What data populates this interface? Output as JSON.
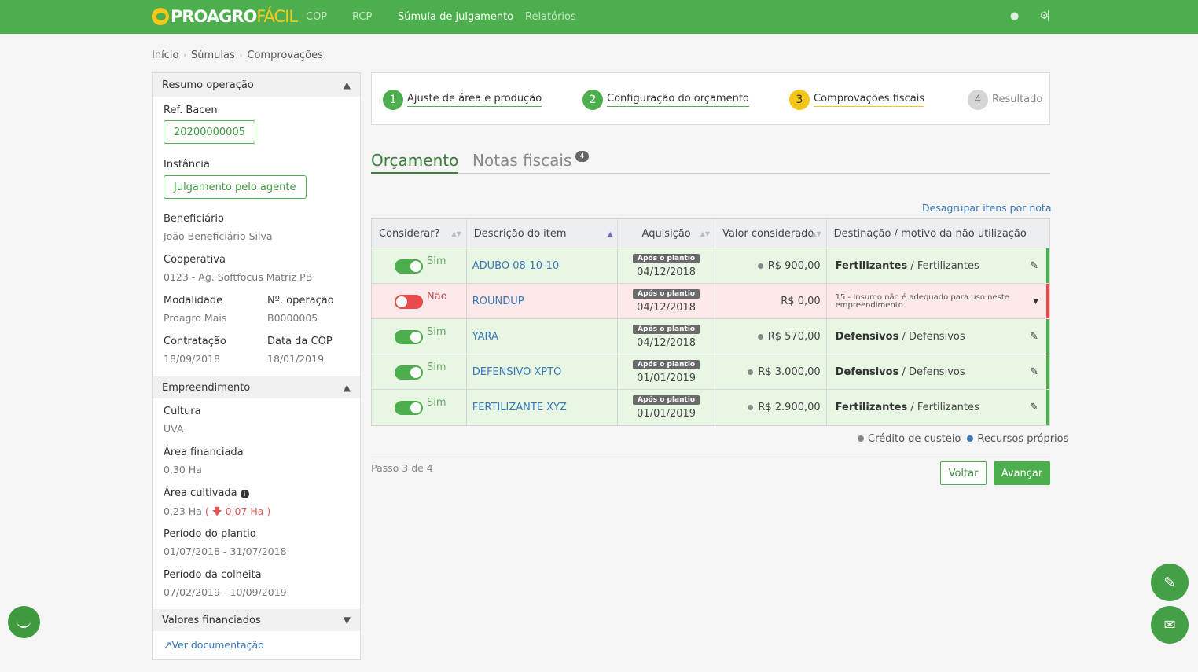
{
  "topbar": {
    "logo_part1": "PROAGRO",
    "logo_part2": "FÁCIL",
    "nav": [
      "COP",
      "RCP",
      "Súmula de julgamento",
      "Relatórios"
    ],
    "active_nav": "Súmula de julgamento"
  },
  "breadcrumb": [
    "Início",
    "Súmulas",
    "Comprovações"
  ],
  "sidebar": {
    "resumo_title": "Resumo operação",
    "ref_bacen_label": "Ref. Bacen",
    "ref_bacen_value": "20200000005",
    "instancia_label": "Instância",
    "instancia_value": "Julgamento pelo agente",
    "beneficiario_label": "Beneficiário",
    "beneficiario_value": "João Beneficiário Silva",
    "cooperativa_label": "Cooperativa",
    "cooperativa_value": "0123 - Ag. Softfocus Matriz PB",
    "modalidade_label": "Modalidade",
    "modalidade_value": "Proagro Mais",
    "operacao_label": "Nº. operação",
    "operacao_value": "B0000005",
    "contratacao_label": "Contratação",
    "contratacao_value": "18/09/2018",
    "data_cop_label": "Data da COP",
    "data_cop_value": "18/01/2019",
    "empreendimento_title": "Empreendimento",
    "cultura_label": "Cultura",
    "cultura_value": "UVA",
    "area_fin_label": "Área financiada",
    "area_fin_value": "0,30 Ha",
    "area_cult_label": "Área cultivada",
    "area_cult_value": "0,23 Ha",
    "area_cult_diff": "0,07 Ha",
    "plantio_label": "Período do plantio",
    "plantio_value": "01/07/2018 - 31/07/2018",
    "colheita_label": "Período da colheita",
    "colheita_value": "07/02/2019 - 10/09/2019",
    "valores_title": "Valores financiados",
    "doc_link": "Ver documentação"
  },
  "steps": [
    {
      "num": "1",
      "label": "Ajuste de área e produção",
      "state": "done",
      "color": "#4cae4c"
    },
    {
      "num": "2",
      "label": "Configuração do orçamento",
      "state": "done",
      "color": "#4cae4c"
    },
    {
      "num": "3",
      "label": "Comprovações fiscais",
      "state": "current",
      "color": "#f5c518"
    },
    {
      "num": "4",
      "label": "Resultado",
      "state": "pending",
      "color": "#cfcfcf"
    }
  ],
  "tabs": {
    "active": "Orçamento",
    "inactive": "Notas fiscais",
    "count": "4"
  },
  "ungroup_link": "Desagrupar itens por nota",
  "table": {
    "headers": [
      "Considerar?",
      "Descrição do item",
      "Aquisição",
      "Valor considerado",
      "Destinação / motivo da não utilização"
    ],
    "acq_badge": "Após o plantio",
    "rows": [
      {
        "consider": true,
        "consider_label": "Sim",
        "desc": "ADUBO 08-10-10",
        "date": "04/12/2018",
        "value": "R$ 900,00",
        "dot": true,
        "dest_bold": "Fertilizantes",
        "dest_rest": " / Fertilizantes",
        "icon": "pencil-icon"
      },
      {
        "consider": false,
        "consider_label": "Não",
        "desc": "ROUNDUP",
        "date": "04/12/2018",
        "value": "R$ 0,00",
        "dot": false,
        "dest_small": "15 - Insumo não é adequado para uso neste empreendimento",
        "icon": "caret-down-icon"
      },
      {
        "consider": true,
        "consider_label": "Sim",
        "desc": "YARA",
        "date": "04/12/2018",
        "value": "R$ 570,00",
        "dot": true,
        "dest_bold": "Defensivos",
        "dest_rest": " / Defensivos",
        "icon": "pencil-icon"
      },
      {
        "consider": true,
        "consider_label": "Sim",
        "desc": "DEFENSIVO XPTO",
        "date": "01/01/2019",
        "value": "R$ 3.000,00",
        "dot": true,
        "dest_bold": "Defensivos",
        "dest_rest": " / Defensivos",
        "icon": "pencil-icon"
      },
      {
        "consider": true,
        "consider_label": "Sim",
        "desc": "FERTILIZANTE XYZ",
        "date": "01/01/2019",
        "value": "R$ 2.900,00",
        "dot": true,
        "dest_bold": "Fertilizantes",
        "dest_rest": " / Fertilizantes",
        "icon": "pencil-icon"
      }
    ]
  },
  "legend": {
    "credito": "Crédito de custeio",
    "credito_color": "#888888",
    "recursos": "Recursos próprios",
    "recursos_color": "#3a78b7"
  },
  "footer": {
    "step_text": "Passo 3 de 4",
    "back": "Voltar",
    "next": "Avançar"
  }
}
